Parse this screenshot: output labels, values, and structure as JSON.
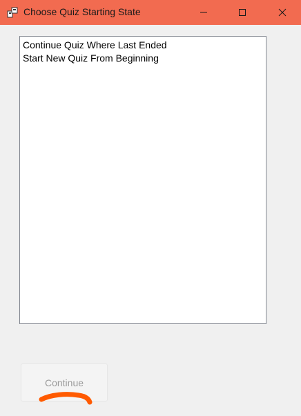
{
  "window": {
    "title": "Choose Quiz Starting State",
    "titlebar_color": "#f26b50",
    "icons": [
      "app-icon",
      "minimize-icon",
      "maximize-icon",
      "close-icon"
    ]
  },
  "listbox": {
    "items": [
      "Continue Quiz Where Last Ended",
      "Start New Quiz From Beginning"
    ]
  },
  "actions": {
    "continue_label": "Continue",
    "continue_state": "disabled"
  },
  "annotation": {
    "color": "#ff5a00",
    "description": "hand-drawn orange underline beneath the Continue button"
  }
}
